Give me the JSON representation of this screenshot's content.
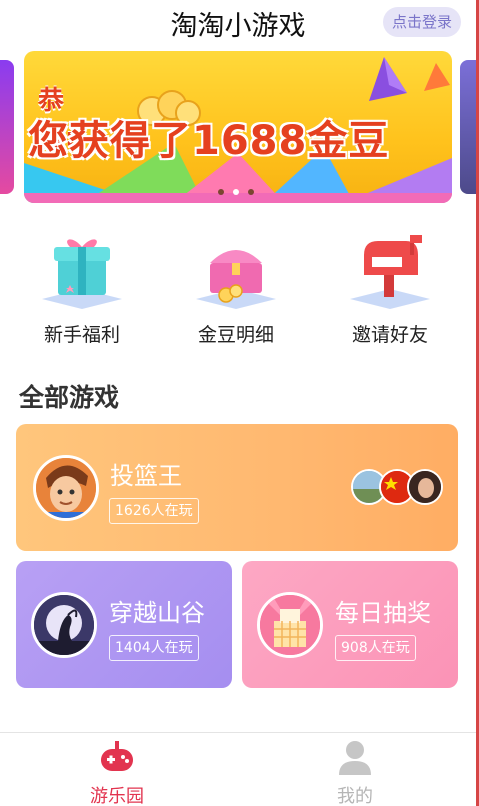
{
  "header": {
    "title": "淘淘小游戏",
    "login_label": "点击登录"
  },
  "banner": {
    "line1": "恭喜:",
    "line2": "您获得了1688金豆",
    "dots_total": 3,
    "dots_active_index": 1
  },
  "quick_entries": [
    {
      "label": "新手福利",
      "icon": "gift-box-icon"
    },
    {
      "label": "金豆明细",
      "icon": "treasure-chest-icon"
    },
    {
      "label": "邀请好友",
      "icon": "mailbox-icon"
    }
  ],
  "section": {
    "title": "全部游戏"
  },
  "games": [
    {
      "name": "投篮王",
      "players": "1626人在玩",
      "color": "#ffb870"
    },
    {
      "name": "穿越山谷",
      "players": "1404人在玩",
      "color": "#ab95f2"
    },
    {
      "name": "每日抽奖",
      "players": "908人在玩",
      "color": "#fc9dbd"
    }
  ],
  "tabbar": [
    {
      "label": "游乐园",
      "icon": "gamepad-icon",
      "active": true,
      "color": "#e2344f"
    },
    {
      "label": "我的",
      "icon": "user-icon",
      "active": false,
      "color": "#b5b5b5"
    }
  ]
}
